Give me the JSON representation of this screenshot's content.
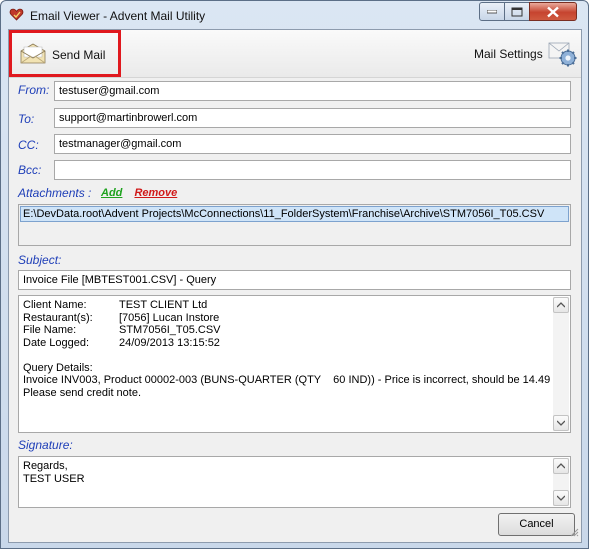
{
  "window": {
    "title": "Email Viewer - Advent Mail Utility"
  },
  "toolbar": {
    "send_label": "Send Mail",
    "settings_label": "Mail Settings",
    "highlight_color": "#e0181e"
  },
  "form": {
    "from_label": "From:",
    "from_value": "testuser@gmail.com",
    "to_label": "To:",
    "to_value": "support@martinbrowerl.com",
    "cc_label": "CC:",
    "cc_value": "testmanager@gmail.com",
    "bcc_label": "Bcc:",
    "bcc_value": "",
    "attachments_label": "Attachments :",
    "add_label": "Add",
    "remove_label": "Remove",
    "attachments": [
      "E:\\DevData.root\\Advent Projects\\McConnections\\11_FolderSystem\\Franchise\\Archive\\STM7056I_T05.CSV"
    ],
    "subject_label": "Subject:",
    "subject_value": "Invoice File [MBTEST001.CSV] - Query",
    "body": {
      "details": [
        {
          "key": "Client Name:",
          "value": "TEST CLIENT Ltd"
        },
        {
          "key": "Restaurant(s):",
          "value": "[7056] Lucan Instore"
        },
        {
          "key": "File Name:",
          "value": "STM7056I_T05.CSV"
        },
        {
          "key": "Date Logged:",
          "value": "24/09/2013 13:15:52"
        }
      ],
      "query_heading": "Query Details:",
      "query_line1": "Invoice INV003, Product 00002-003 (BUNS-QUARTER (QTY    60 IND)) - Price is incorrect, should be 14.49",
      "query_line2": "Please send credit note."
    },
    "signature_label": "Signature:",
    "signature_line1": "Regards,",
    "signature_line2": "TEST USER"
  },
  "footer": {
    "cancel_label": "Cancel"
  }
}
